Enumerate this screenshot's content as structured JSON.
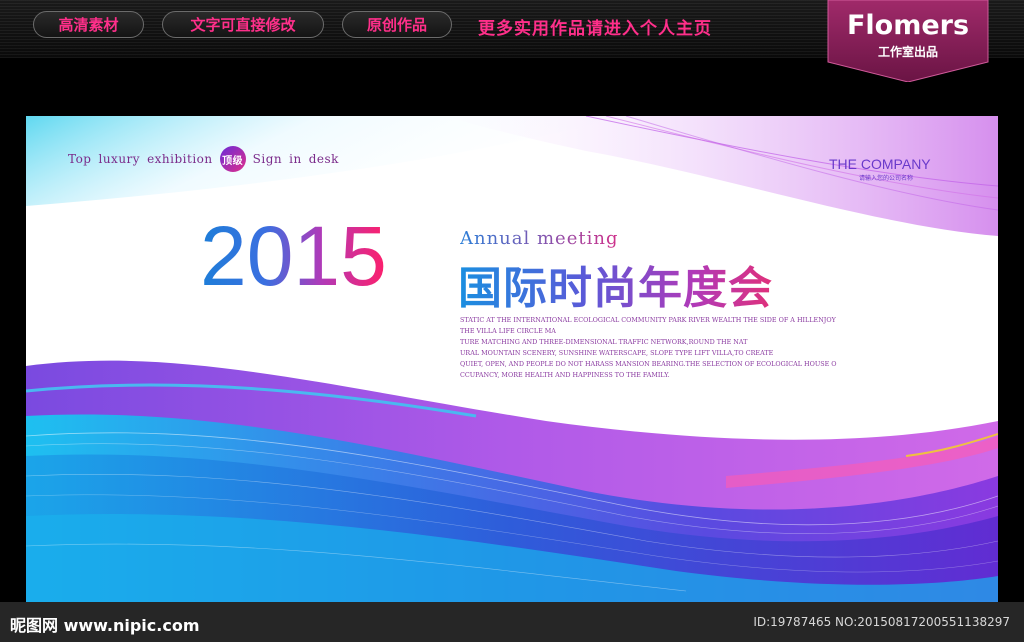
{
  "header": {
    "pills": [
      "高清素材",
      "文字可直接修改",
      "原创作品"
    ],
    "promo": "更多实用作品请进入个人主页",
    "brand": "Flomers",
    "brand_sub": "工作室出品"
  },
  "banner": {
    "tagline_left": [
      "Top",
      "luxury",
      "exhibition"
    ],
    "badge": "顶级",
    "tagline_right": [
      "Sign",
      "in",
      "desk"
    ],
    "company": "THE COMPANY",
    "company_sub": "请输入您的公司名称",
    "year": "2015",
    "annual": "Annual  meeting",
    "title": "国际时尚年度会",
    "blurb": [
      "STATIC AT THE INTERNATIONAL ECOLOGICAL COMMUNITY PARK RIVER WEALTH THE SIDE OF A HILLENJOY",
      "THE VILLA LIFE CIRCLE MA",
      "TURE MATCHING AND THREE-DIMENSIONAL TRAFFIC NETWORK,ROUND THE NAT",
      "URAL MOUNTAIN SCENERY, SUNSHINE WATERSCAPE, SLOPE TYPE LIFT VILLA,TO CREATE",
      "QUIET, OPEN, AND PEOPLE DO NOT HARASS MANSION BEARING.THE SELECTION OF ECOLOGICAL HOUSE O",
      "CCUPANCY, MORE HEALTH AND HAPPINESS TO THE FAMILY."
    ]
  },
  "footer": {
    "site": "昵图网 www.nipic.com",
    "photo_id": "ID:19787465 NO:20150817200551138297"
  },
  "colors": {
    "accent_pink": "#ff2f8a",
    "brand_plum": "#8a1f5a",
    "wave_blue": "#1d8fe0",
    "wave_purple": "#8a3ae0"
  }
}
